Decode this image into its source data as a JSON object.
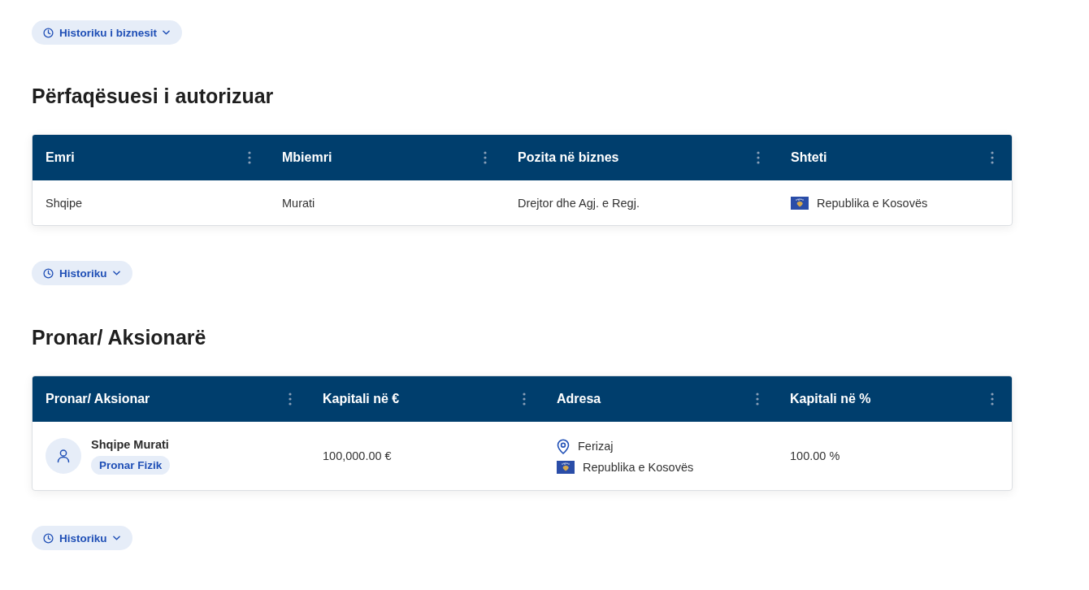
{
  "business_history_button": {
    "label": "Historiku i biznesit"
  },
  "sections": [
    {
      "title": "Përfaqësuesi i autorizuar",
      "table": {
        "columns": [
          "Emri",
          "Mbiemri",
          "Pozita në biznes",
          "Shteti"
        ],
        "rows": [
          {
            "cells": [
              {
                "kind": "text",
                "text": "Shqipe"
              },
              {
                "kind": "text",
                "text": "Murati"
              },
              {
                "kind": "text",
                "text": "Drejtor dhe Agj. e Regj."
              },
              {
                "kind": "country",
                "text": "Republika e Kosovës"
              }
            ]
          }
        ]
      },
      "history_button": {
        "label": "Historiku"
      }
    },
    {
      "title": "Pronar/ Aksionarë",
      "table": {
        "columns": [
          "Pronar/ Aksionar",
          "Kapitali në €",
          "Adresa",
          "Kapitali në %"
        ],
        "rows": [
          {
            "cells": [
              {
                "kind": "owner",
                "name": "Shqipe Murati",
                "badge": "Pronar Fizik"
              },
              {
                "kind": "text",
                "text": "100,000.00 €"
              },
              {
                "kind": "address",
                "city": "Ferizaj",
                "country": "Republika e Kosovës"
              },
              {
                "kind": "text",
                "text": "100.00 %"
              }
            ]
          }
        ]
      },
      "history_button": {
        "label": "Historiku"
      }
    }
  ]
}
